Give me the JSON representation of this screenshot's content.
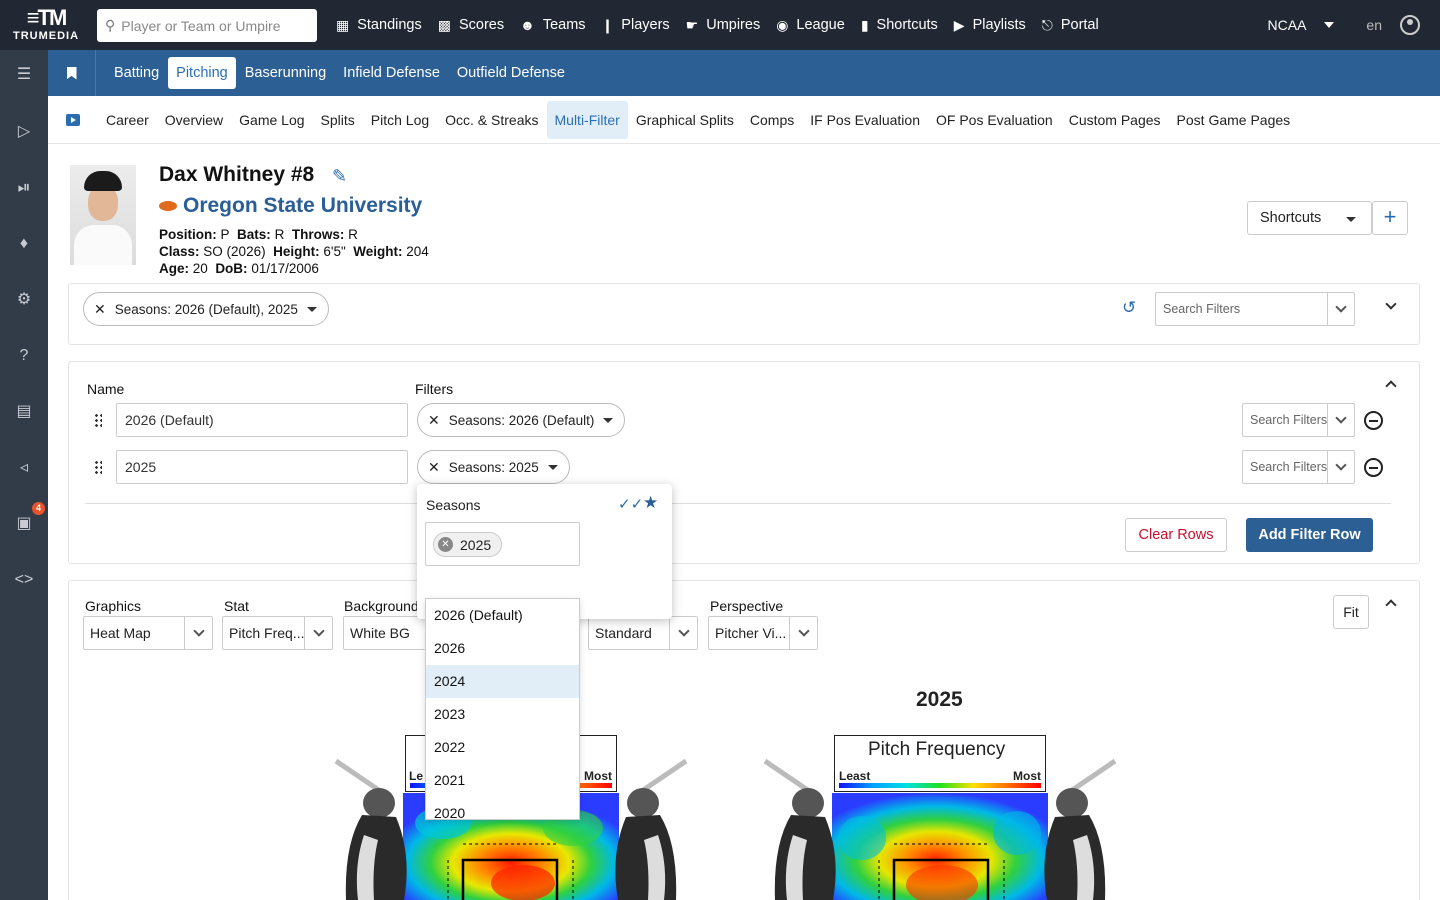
{
  "brand": {
    "name": "TRUMEDIA"
  },
  "search": {
    "placeholder": "Player or Team or Umpire"
  },
  "nav": [
    {
      "label": "Standings",
      "icon": "table-icon"
    },
    {
      "label": "Scores",
      "icon": "grid-icon"
    },
    {
      "label": "Teams",
      "icon": "users-icon"
    },
    {
      "label": "Players",
      "icon": "person-icon"
    },
    {
      "label": "Umpires",
      "icon": "thumb-icon"
    },
    {
      "label": "League",
      "icon": "baseballs-icon"
    },
    {
      "label": "Shortcuts",
      "icon": "bookmark-icon"
    },
    {
      "label": "Playlists",
      "icon": "playlist-icon"
    },
    {
      "label": "Portal",
      "icon": "portal-icon"
    }
  ],
  "top_right": {
    "league": "NCAA",
    "lang": "en"
  },
  "sidebar": {
    "notification_count": "4"
  },
  "category_tabs": [
    "Batting",
    "Pitching",
    "Baserunning",
    "Infield Defense",
    "Outfield Defense"
  ],
  "active_category": "Pitching",
  "sub_tabs": [
    "Career",
    "Overview",
    "Game Log",
    "Splits",
    "Pitch Log",
    "Occ. & Streaks",
    "Multi-Filter",
    "Graphical Splits",
    "Comps",
    "IF Pos Evaluation",
    "OF Pos Evaluation",
    "Custom Pages",
    "Post Game Pages"
  ],
  "active_sub_tab": "Multi-Filter",
  "player": {
    "name": "Dax Whitney  #8",
    "school": "Oregon State University",
    "position_label": "Position:",
    "position": "P",
    "bats_label": "Bats:",
    "bats": "R",
    "throws_label": "Throws:",
    "throws": "R",
    "class_label": "Class:",
    "class": "SO (2026)",
    "height_label": "Height:",
    "height": "6'5\"",
    "weight_label": "Weight:",
    "weight": "204",
    "age_label": "Age:",
    "age": "20",
    "dob_label": "DoB:",
    "dob": "01/17/2006"
  },
  "header_actions": {
    "shortcuts": "Shortcuts",
    "plus": "+"
  },
  "global_filter": {
    "chip": "Seasons: 2026 (Default), 2025",
    "search_placeholder": "Search Filters"
  },
  "multi_filter": {
    "name_header": "Name",
    "filters_header": "Filters",
    "rows": [
      {
        "name": "2026 (Default)",
        "chip": "Seasons: 2026 (Default)",
        "search_placeholder": "Search Filters"
      },
      {
        "name": "2025",
        "chip": "Seasons: 2025",
        "search_placeholder": "Search Filters"
      }
    ],
    "clear_rows": "Clear Rows",
    "add_filter_row": "Add Filter Row"
  },
  "graphics": {
    "graphics_label": "Graphics",
    "graphics_value": "Heat Map",
    "stat_label": "Stat",
    "stat_value": "Pitch Freq...",
    "background_label": "Background",
    "background_value": "White BG",
    "scale_value": "Standard",
    "perspective_label": "Perspective",
    "perspective_value": "Pitcher Vi...",
    "fit": "Fit"
  },
  "charts": [
    {
      "title": "",
      "legend_title": "",
      "least": "Le",
      "most": "Most"
    },
    {
      "title": "2025",
      "legend_title": "Pitch Frequency",
      "least": "Least",
      "most": "Most"
    }
  ],
  "colors": {
    "heat_low": "#1010ff",
    "heat_mid": "#20e020",
    "heat_high": "#ff0000"
  },
  "seasons_popover": {
    "title": "Seasons",
    "selected_tag": "2025",
    "options": [
      "2026 (Default)",
      "2026",
      "2024",
      "2023",
      "2022",
      "2021",
      "2020"
    ],
    "highlighted": "2024"
  }
}
